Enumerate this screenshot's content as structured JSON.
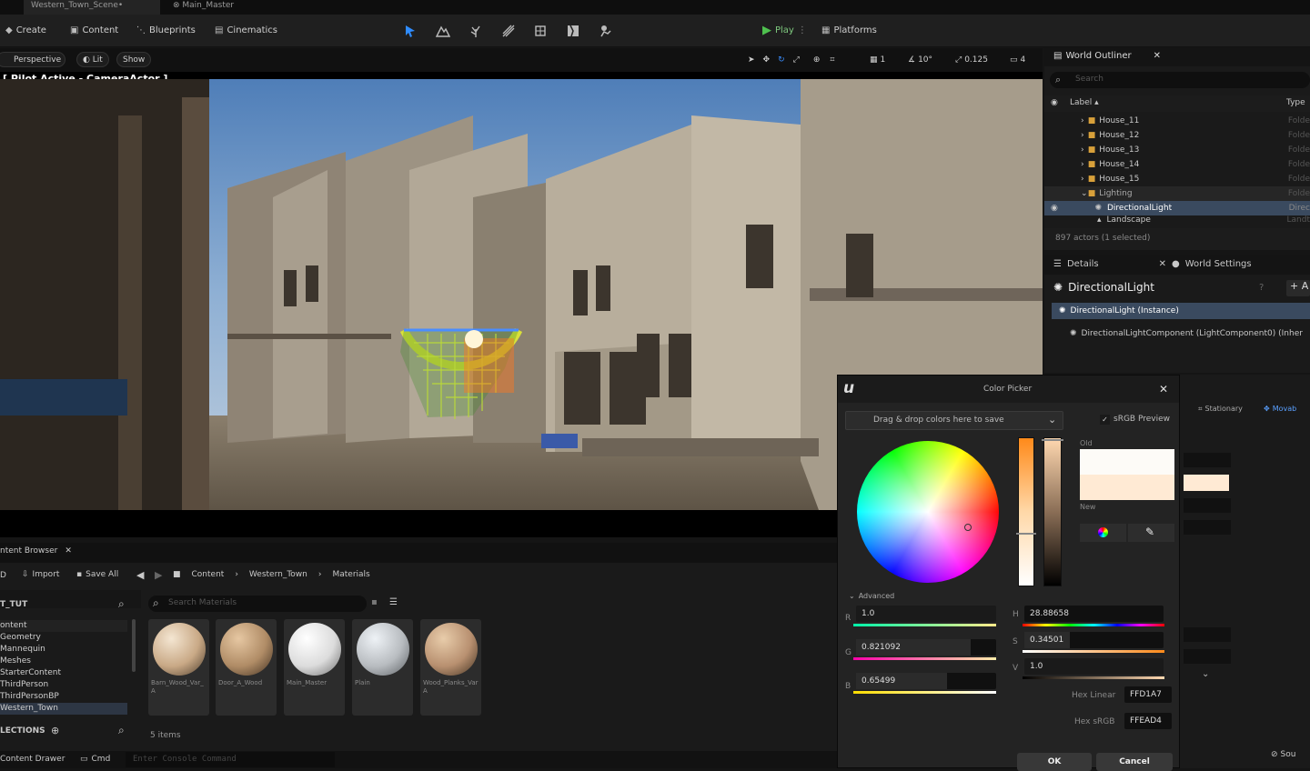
{
  "tabs": {
    "scene": "Western_Town_Scene•",
    "material": "Main_Master"
  },
  "toolbar": {
    "create": "Create",
    "content": "Content",
    "blueprints": "Blueprints",
    "cinematics": "Cinematics",
    "play": "Play",
    "platforms": "Platforms"
  },
  "viewport": {
    "perspective": "Perspective",
    "lit": "Lit",
    "show": "Show",
    "pilot": "[ Pilot Active - CameraActor ]",
    "grid": "1",
    "angle": "10°",
    "scale": "0.125",
    "camera": "4"
  },
  "outliner": {
    "title": "World Outliner",
    "search_placeholder": "Search",
    "col_label": "Label ▴",
    "col_type": "Type",
    "rows": [
      {
        "label": "House_11",
        "type": "Folde"
      },
      {
        "label": "House_12",
        "type": "Folde"
      },
      {
        "label": "House_13",
        "type": "Folde"
      },
      {
        "label": "House_14",
        "type": "Folde"
      },
      {
        "label": "House_15",
        "type": "Folde"
      },
      {
        "label": "Lighting",
        "type": "Folde"
      },
      {
        "label": "DirectionalLight",
        "type": "Direc"
      },
      {
        "label": "Landscape",
        "type": "Landt"
      }
    ],
    "status": "897 actors (1 selected)"
  },
  "details": {
    "tab": "Details",
    "world_settings": "World Settings",
    "actor": "DirectionalLight",
    "add": "+ A",
    "instance": "DirectionalLight (Instance)",
    "component": "DirectionalLightComponent (LightComponent0) (Inher"
  },
  "color_picker": {
    "title": "Color Picker",
    "drag_drop": "Drag & drop colors here to save",
    "srgb_preview": "sRGB Preview",
    "old": "Old",
    "new": "New",
    "advanced": "Advanced",
    "r_label": "R",
    "r": "1.0",
    "g_label": "G",
    "g": "0.821092",
    "b_label": "B",
    "b": "0.65499",
    "h_label": "H",
    "h": "28.88658",
    "s_label": "S",
    "s": "0.34501",
    "v_label": "V",
    "v": "1.0",
    "hex_linear_label": "Hex Linear",
    "hex_linear": "FFD1A7",
    "hex_srgb_label": "Hex sRGB",
    "hex_srgb": "FFEAD4",
    "ok": "OK",
    "cancel": "Cancel",
    "old_color": "#fdfbf7",
    "new_color": "#ffead4"
  },
  "right_panel": {
    "stationary": "Stationary",
    "movable": "Movab"
  },
  "content_browser": {
    "title": "ntent Browser",
    "add": "D",
    "import": "Import",
    "save_all": "Save All",
    "path": [
      "Content",
      "Western_Town",
      "Materials"
    ],
    "tree_title": "T_TUT",
    "tree": [
      "ontent",
      "Geometry",
      "Mannequin",
      "Meshes",
      "StarterContent",
      "ThirdPerson",
      "ThirdPersonBP",
      "Western_Town"
    ],
    "collections": "LECTIONS",
    "search_placeholder": "Search Materials",
    "materials": [
      {
        "name": "Barn_Wood_Var_A",
        "color": "#c9a986"
      },
      {
        "name": "Door_A_Wood",
        "color": "#b08c66"
      },
      {
        "name": "Main_Master",
        "color": "#dcdcdc"
      },
      {
        "name": "Plain",
        "color": "#b8bcc0"
      },
      {
        "name": "Wood_Planks_VarA",
        "color": "#b89070"
      }
    ],
    "count": "5 items"
  },
  "status": {
    "drawer": "Content Drawer",
    "cmd": "Cmd",
    "console_placeholder": "Enter Console Command",
    "source": "Sou"
  }
}
